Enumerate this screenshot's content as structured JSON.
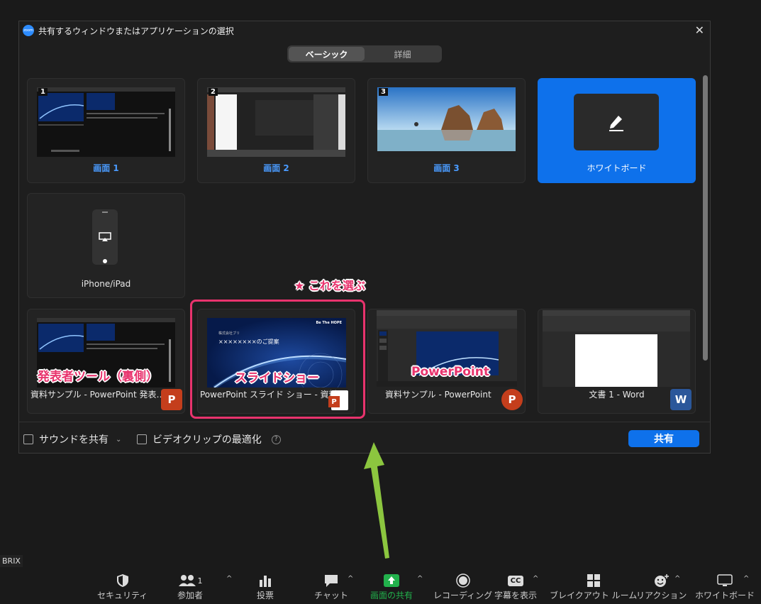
{
  "window": {
    "title": "共有するウィンドウまたはアプリケーションの選択",
    "logo": "zoom",
    "close_symbol": "✕"
  },
  "tabs": [
    {
      "label": "ベーシック",
      "active": true
    },
    {
      "label": "詳細",
      "active": false
    }
  ],
  "screens": [
    {
      "number": "1",
      "label": "画面 1"
    },
    {
      "number": "2",
      "label": "画面 2"
    },
    {
      "number": "3",
      "label": "画面 3"
    }
  ],
  "whiteboard": {
    "label": "ホワイトボード"
  },
  "iphone": {
    "label": "iPhone/iPad"
  },
  "apps": [
    {
      "label": "資料サンプル - PowerPoint 発表…",
      "icon": "P"
    },
    {
      "label": "PowerPoint スライド ショー - 資料…",
      "icon": "P"
    },
    {
      "label": "資料サンプル - PowerPoint",
      "icon": "P"
    },
    {
      "label": "文書 1 - Word",
      "icon": "W"
    }
  ],
  "annotations": {
    "choose": "★ これを選ぶ",
    "presenter": "発表者ツール（裏側）",
    "slideshow": "スライドショー",
    "powerpoint": "PowerPoint",
    "color": "#e8336d"
  },
  "slide": {
    "company": "株式会社ブリ",
    "title": "××××××××のご提案",
    "brand": "Be The HOPE"
  },
  "footer": {
    "sound": "サウンドを共有",
    "video": "ビデオクリップの最適化",
    "share": "共有"
  },
  "side_label": "BRIX",
  "toolbar": [
    {
      "label": "セキュリティ"
    },
    {
      "label": "参加者",
      "count": "1"
    },
    {
      "label": "投票"
    },
    {
      "label": "チャット"
    },
    {
      "label": "画面の共有"
    },
    {
      "label": "レコーディング"
    },
    {
      "label": "字幕を表示",
      "icon_text": "CC"
    },
    {
      "label": "ブレイクアウト ルーム"
    },
    {
      "label": "リアクション"
    },
    {
      "label": "ホワイトボード"
    }
  ],
  "colors": {
    "accent": "#0e71eb",
    "share_green": "#22b14c",
    "arrow": "#8cc63f"
  }
}
